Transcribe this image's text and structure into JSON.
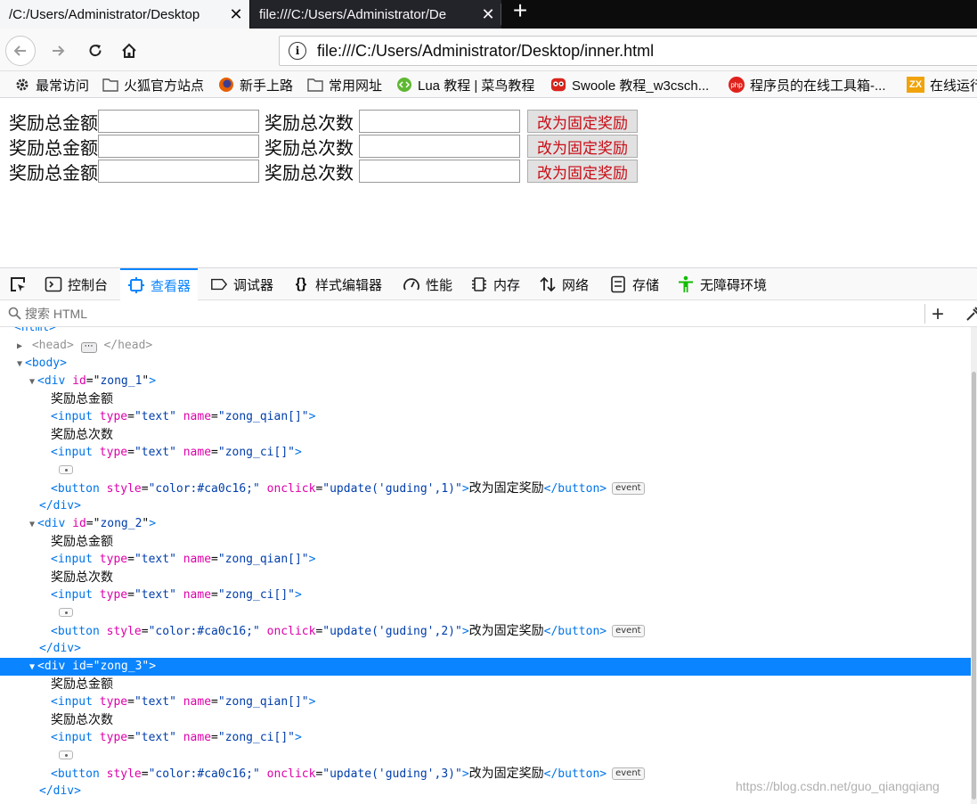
{
  "tabs": [
    {
      "title": "/C:/Users/Administrator/Desktop",
      "close": "✕"
    },
    {
      "title": "file:///C:/Users/Administrator/De",
      "close": "✕"
    }
  ],
  "new_tab": "+",
  "url": "file:///C:/Users/Administrator/Desktop/inner.html",
  "bookmarks": [
    {
      "label": "最常访问",
      "icon": "gear-icon"
    },
    {
      "label": "火狐官方站点",
      "icon": "folder-icon"
    },
    {
      "label": "新手上路",
      "icon": "firefox-icon"
    },
    {
      "label": "常用网址",
      "icon": "folder-icon"
    },
    {
      "label": "Lua 教程 | 菜鸟教程",
      "icon": "lua-icon"
    },
    {
      "label": "Swoole 教程_w3csch...",
      "icon": "owl-icon"
    },
    {
      "label": "程序员的在线工具箱-...",
      "icon": "php-icon",
      "icon_text": "php"
    },
    {
      "label": "在线运行",
      "icon": "zx-icon",
      "icon_text": "ZX"
    }
  ],
  "form_rows": [
    {
      "amount_label": "奖励总金额",
      "count_label": "奖励总次数",
      "button": "改为固定奖励"
    },
    {
      "amount_label": "奖励总金额",
      "count_label": "奖励总次数",
      "button": "改为固定奖励"
    },
    {
      "amount_label": "奖励总金额",
      "count_label": "奖励总次数",
      "button": "改为固定奖励"
    }
  ],
  "button_color": "#ca0c16",
  "devtools": {
    "tabs": [
      {
        "label": "控制台",
        "icon": "console-icon"
      },
      {
        "label": "查看器",
        "icon": "inspector-icon",
        "active": true
      },
      {
        "label": "调试器",
        "icon": "debugger-icon"
      },
      {
        "label": "样式编辑器",
        "icon": "braces-icon",
        "icon_text": "{}"
      },
      {
        "label": "性能",
        "icon": "gauge-icon"
      },
      {
        "label": "内存",
        "icon": "chip-icon"
      },
      {
        "label": "网络",
        "icon": "arrows-icon"
      },
      {
        "label": "存储",
        "icon": "storage-icon"
      },
      {
        "label": "无障碍环境",
        "icon": "accessibility-icon"
      }
    ],
    "search_placeholder": "搜索 HTML",
    "plus": "+",
    "tree": {
      "html_tag": "<html>",
      "head_open": "<head>",
      "head_close": "</head>",
      "body_tag": "<body>",
      "divs": [
        {
          "open_tag": "<div",
          "attr": "id",
          "id": "zong_1",
          "arg": "1"
        },
        {
          "open_tag": "<div",
          "attr": "id",
          "id": "zong_2",
          "arg": "2"
        },
        {
          "open_tag": "<div",
          "attr": "id",
          "id": "zong_3",
          "arg": "3"
        }
      ],
      "text_amount": "奖励总金额",
      "text_count": "奖励总次数",
      "input_tag": "<input",
      "type_attr": "type",
      "type_val": "\"text\"",
      "name_attr": "name",
      "name_qian": "\"zong_qian[]\"",
      "name_ci": "\"zong_ci[]\"",
      "button_tag": "<button",
      "style_attr": "style",
      "style_val": "\"color:#ca0c16;\"",
      "onclick_attr": "onclick",
      "button_text": "改为固定奖励",
      "button_close": "</button>",
      "div_close": "</div>",
      "event_badge": "event",
      "ellipsis": "⋯"
    }
  },
  "watermark": "https://blog.csdn.net/guo_qiangqiang"
}
